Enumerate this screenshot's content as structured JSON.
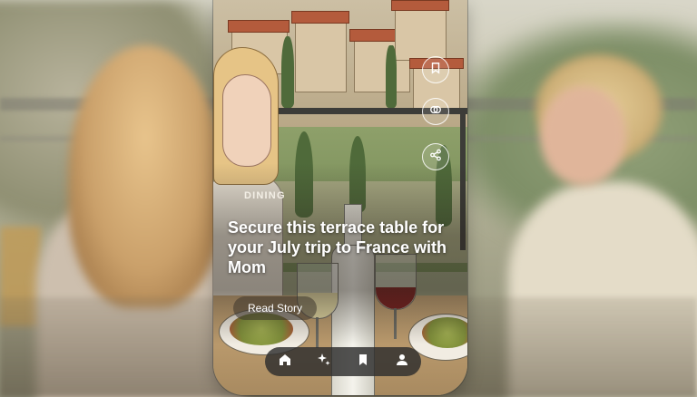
{
  "story": {
    "category": "DINING",
    "headline": "Secure this terrace table for your July trip to France with Mom",
    "cta_label": "Read Story"
  },
  "actions": [
    {
      "icon": "save-icon"
    },
    {
      "icon": "remix-icon"
    },
    {
      "icon": "share-icon"
    }
  ],
  "nav": {
    "items": [
      {
        "icon": "home-icon",
        "active": true
      },
      {
        "icon": "sparkle-icon",
        "active": false
      },
      {
        "icon": "bookmark-icon",
        "active": false
      },
      {
        "icon": "profile-icon",
        "active": false
      }
    ]
  },
  "colors": {
    "nav_bg": "#2d2d2d",
    "text": "#ffffff"
  }
}
